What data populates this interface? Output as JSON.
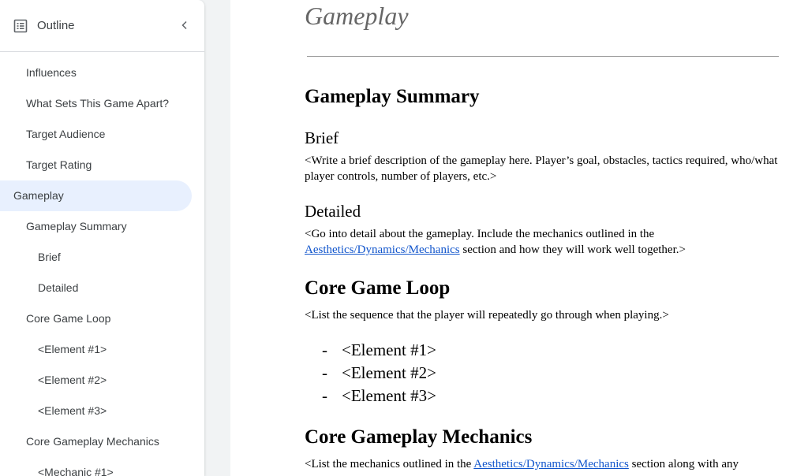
{
  "sidebar": {
    "title": "Outline",
    "items": [
      {
        "label": "Influences",
        "level": 1,
        "active": false
      },
      {
        "label": "What Sets This Game Apart?",
        "level": 1,
        "active": false
      },
      {
        "label": "Target Audience",
        "level": 1,
        "active": false
      },
      {
        "label": "Target Rating",
        "level": 1,
        "active": false
      },
      {
        "label": "Gameplay",
        "level": 0,
        "active": true
      },
      {
        "label": "Gameplay Summary",
        "level": 1,
        "active": false
      },
      {
        "label": "Brief",
        "level": 2,
        "active": false
      },
      {
        "label": "Detailed",
        "level": 2,
        "active": false
      },
      {
        "label": "Core Game Loop",
        "level": 1,
        "active": false
      },
      {
        "label": "<Element #1>",
        "level": 2,
        "active": false
      },
      {
        "label": "<Element #2>",
        "level": 2,
        "active": false
      },
      {
        "label": "<Element #3>",
        "level": 2,
        "active": false
      },
      {
        "label": "Core Gameplay Mechanics",
        "level": 1,
        "active": false
      },
      {
        "label": "<Mechanic #1>",
        "level": 2,
        "active": false
      }
    ]
  },
  "doc": {
    "title": "Gameplay",
    "summary_heading": "Gameplay Summary",
    "brief_heading": "Brief",
    "brief_text": "<Write a brief description of the gameplay here. Player’s goal, obstacles, tactics required, who/what player controls, number of players, etc.>",
    "detailed_heading": "Detailed",
    "detailed_text_before": "<Go into detail about the gameplay. Include the mechanics outlined in the",
    "detailed_link": "Aesthetics/Dynamics/Mechanics",
    "detailed_text_after": " section and how they will work well together.>",
    "loop_heading": "Core Game Loop",
    "loop_text": "<List the sequence that the player will repeatedly go through when playing.>",
    "bullet_marker": "-",
    "loop_elements": [
      "<Element #1>",
      "<Element #2>",
      "<Element #3>"
    ],
    "mechanics_heading": "Core Gameplay Mechanics",
    "mechanics_text_before": "<List the mechanics outlined in the ",
    "mechanics_link": "Aesthetics/Dynamics/Mechanics",
    "mechanics_text_after": " section along with any"
  }
}
